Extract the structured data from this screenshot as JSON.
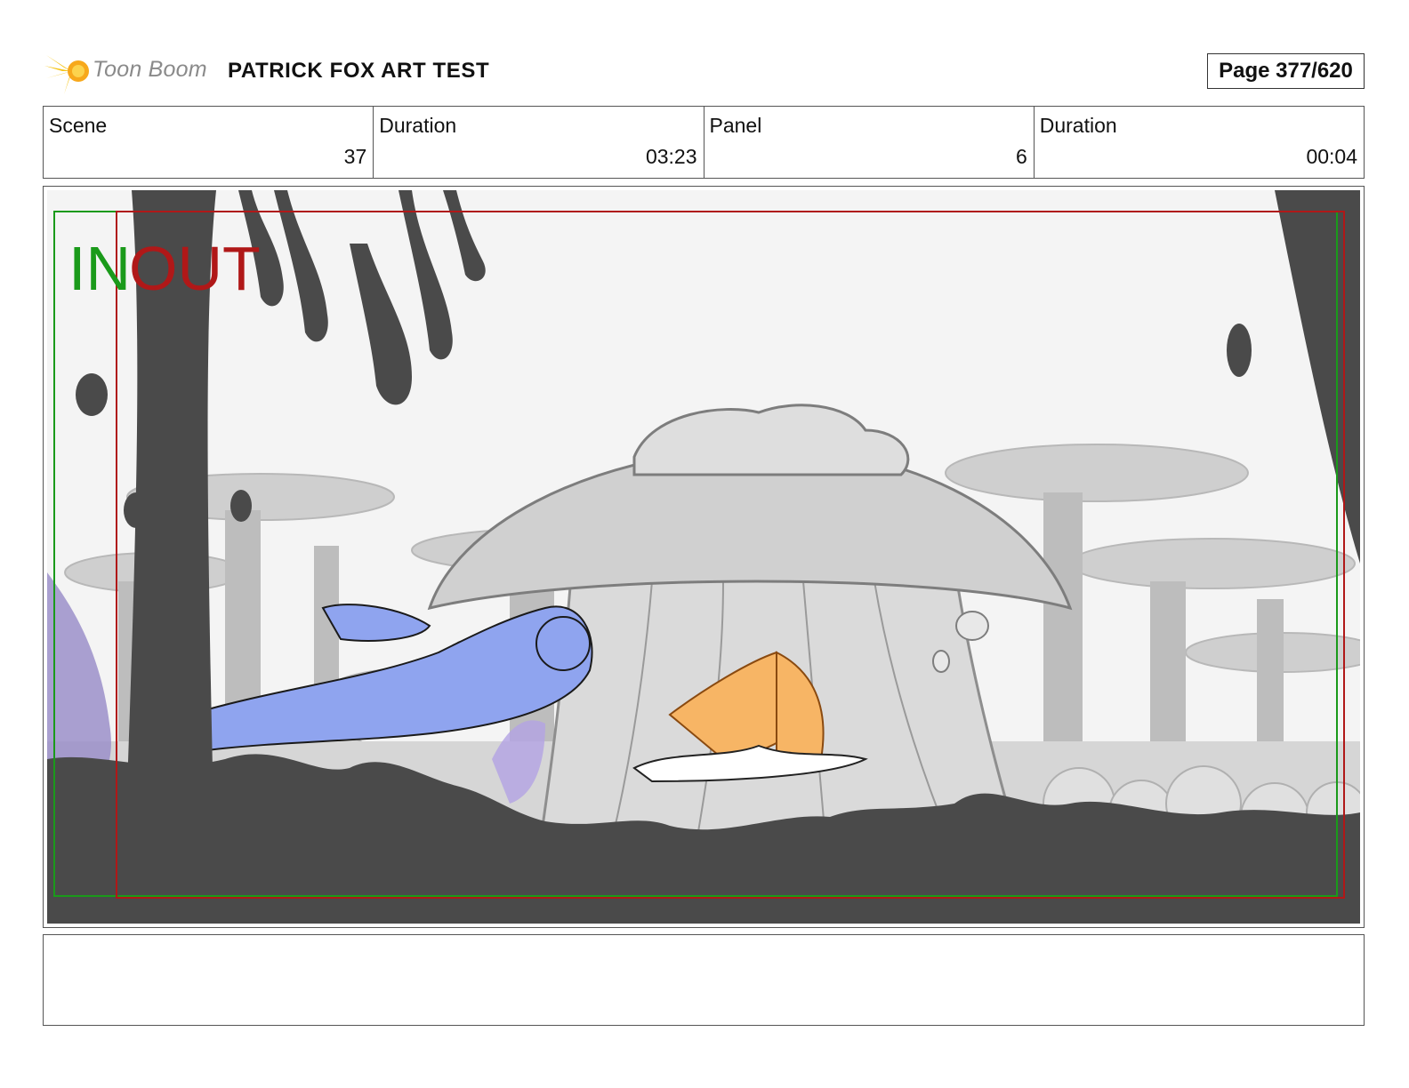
{
  "header": {
    "logo_text": "Toon Boom",
    "title": "PATRICK FOX ART TEST",
    "page": "Page 377/620"
  },
  "info": [
    {
      "label": "Scene",
      "value": "37"
    },
    {
      "label": "Duration",
      "value": "03:23"
    },
    {
      "label": "Panel",
      "value": "6"
    },
    {
      "label": "Duration",
      "value": "00:04"
    }
  ],
  "panel": {
    "in_label": "IN",
    "out_label": "OUT",
    "colors": {
      "in_marker": "#1a9a1a",
      "out_marker": "#b01818",
      "foreground_silhouette": "#4a4a4a",
      "creature_blue": "#8fa4ef",
      "character_orange": "#f7b565",
      "background_gray": "#c9c9c9"
    }
  },
  "notes": {
    "text": ""
  }
}
